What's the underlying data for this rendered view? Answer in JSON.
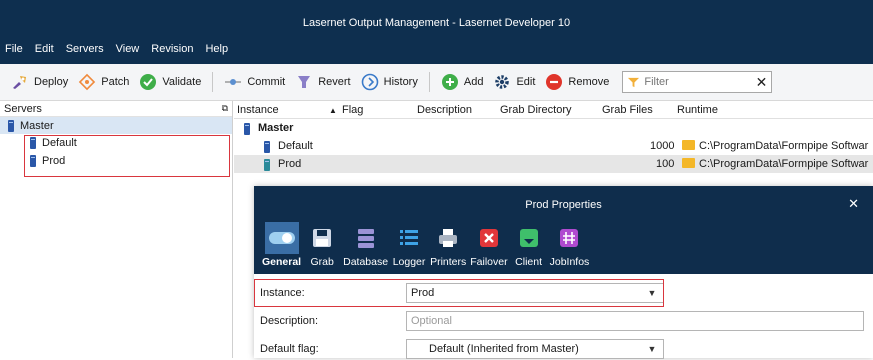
{
  "window": {
    "title": "Lasernet Output Management - Lasernet Developer 10"
  },
  "menu": [
    "File",
    "Edit",
    "Servers",
    "View",
    "Revision",
    "Help"
  ],
  "toolbar": {
    "deploy": "Deploy",
    "patch": "Patch",
    "validate": "Validate",
    "commit": "Commit",
    "revert": "Revert",
    "history": "History",
    "add": "Add",
    "edit": "Edit",
    "remove": "Remove",
    "filter_placeholder": "Filter"
  },
  "servers_panel": {
    "title": "Servers",
    "master": "Master",
    "children": [
      "Default",
      "Prod"
    ]
  },
  "table": {
    "headers": [
      "Instance",
      "Flag",
      "Description",
      "Grab Directory",
      "Grab Files",
      "Runtime"
    ],
    "group": "Master",
    "rows": [
      {
        "instance": "Default",
        "grab_files": "1000",
        "runtime": "C:\\ProgramData\\Formpipe Softwar"
      },
      {
        "instance": "Prod",
        "grab_files": "100",
        "runtime": "C:\\ProgramData\\Formpipe Softwar"
      }
    ]
  },
  "dialog": {
    "title": "Prod Properties",
    "categories": [
      "General",
      "Grab",
      "Database",
      "Logger",
      "Printers",
      "Failover",
      "Client",
      "JobInfos"
    ],
    "fields": {
      "instance_label": "Instance:",
      "instance_value": "Prod",
      "description_label": "Description:",
      "description_placeholder": "Optional",
      "flag_label": "Default flag:",
      "flag_value": "Default (Inherited from Master)"
    }
  },
  "colors": {
    "titlebar": "#0e2f4f",
    "highlight": "#d9363e",
    "accent": "#3a6ea5"
  }
}
